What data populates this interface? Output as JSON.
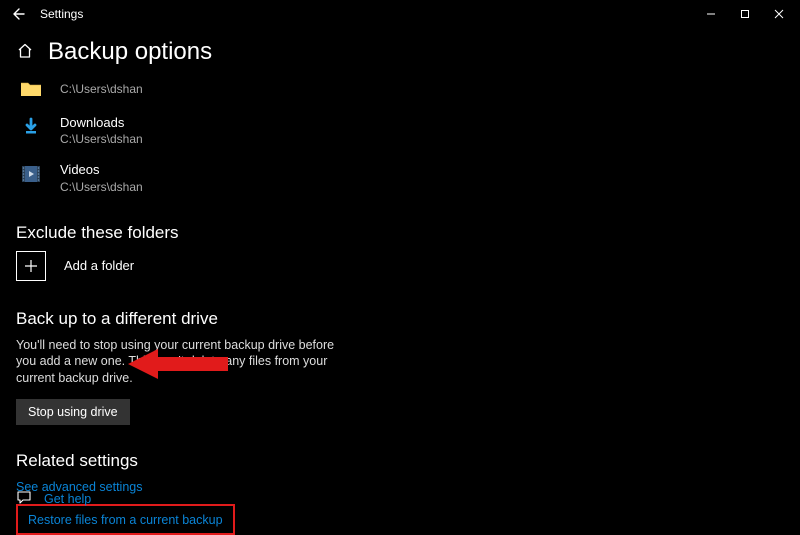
{
  "titlebar": {
    "app_name": "Settings"
  },
  "header": {
    "page_title": "Backup options"
  },
  "folders": [
    {
      "name": "",
      "path": "C:\\Users\\dshan",
      "icon": "folder"
    },
    {
      "name": "Downloads",
      "path": "C:\\Users\\dshan",
      "icon": "download"
    },
    {
      "name": "Videos",
      "path": "C:\\Users\\dshan",
      "icon": "videos"
    }
  ],
  "exclude": {
    "heading": "Exclude these folders",
    "add_label": "Add a folder"
  },
  "different_drive": {
    "heading": "Back up to a different drive",
    "body": "You'll need to stop using your current backup drive before you add a new one. This won't delete any files from your current backup drive.",
    "button": "Stop using drive"
  },
  "related": {
    "heading": "Related settings",
    "advanced_link": "See advanced settings",
    "restore_link": "Restore files from a current backup"
  },
  "help": {
    "label": "Get help"
  }
}
